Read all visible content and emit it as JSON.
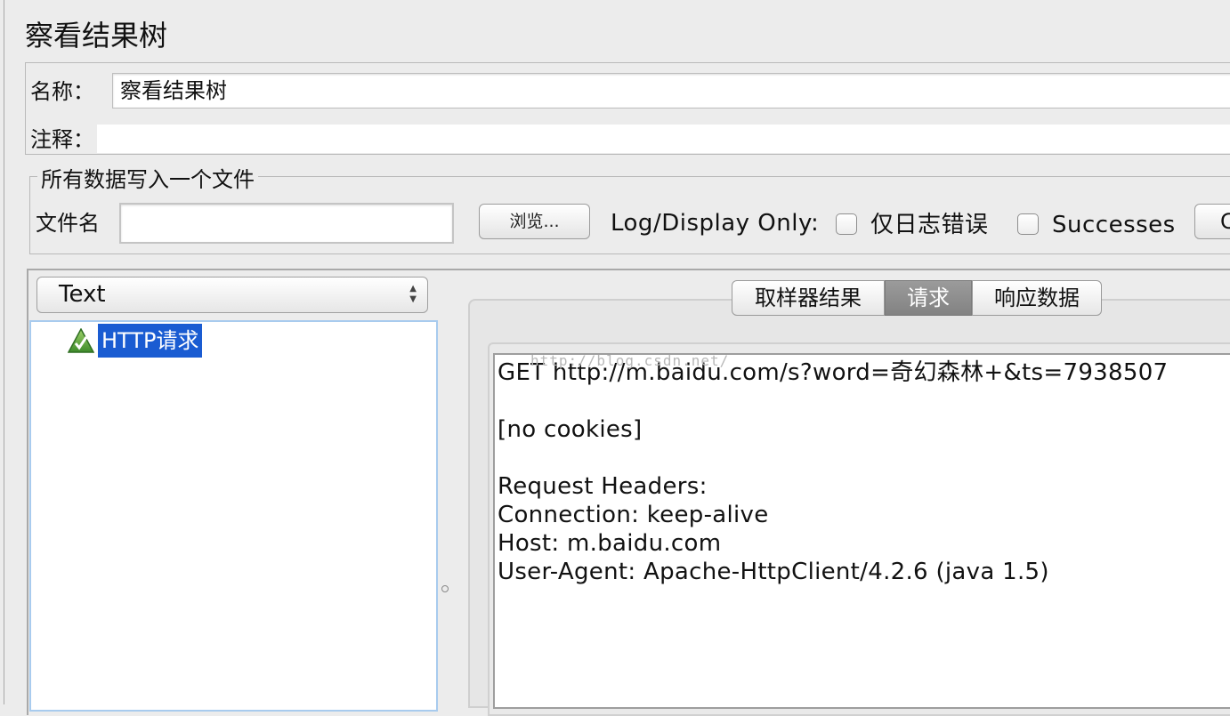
{
  "panel": {
    "title": "察看结果树"
  },
  "fields": {
    "name_label": "名称：",
    "name_value": "察看结果树",
    "comment_label": "注释：",
    "comment_value": ""
  },
  "file_group": {
    "legend": "所有数据写入一个文件",
    "filename_label": "文件名",
    "filename_value": "",
    "browse_label": "浏览...",
    "log_display_label": "Log/Display Only:",
    "errors_label": "仅日志错误",
    "errors_checked": false,
    "successes_label": "Successes",
    "successes_checked": false,
    "cut_button_label": "C"
  },
  "renderer": {
    "selected": "Text"
  },
  "tree": {
    "items": [
      {
        "label": "HTTP请求",
        "status": "success",
        "selected": true
      }
    ]
  },
  "tabs": [
    {
      "label": "取样器结果",
      "active": false
    },
    {
      "label": "请求",
      "active": true
    },
    {
      "label": "响应数据",
      "active": false
    }
  ],
  "request_text": [
    "GET http://m.baidu.com/s?word=奇幻森林+&ts=7938507",
    "",
    "[no cookies]",
    "",
    "Request Headers:",
    "Connection: keep-alive",
    "Host: m.baidu.com",
    "User-Agent: Apache-HttpClient/4.2.6 (java 1.5)"
  ],
  "watermark": "http://blog.csdn.net/",
  "colors": {
    "selection": "#1a5cd2",
    "active_tab": "#8f8f8f",
    "tree_border": "#a8cbee"
  }
}
